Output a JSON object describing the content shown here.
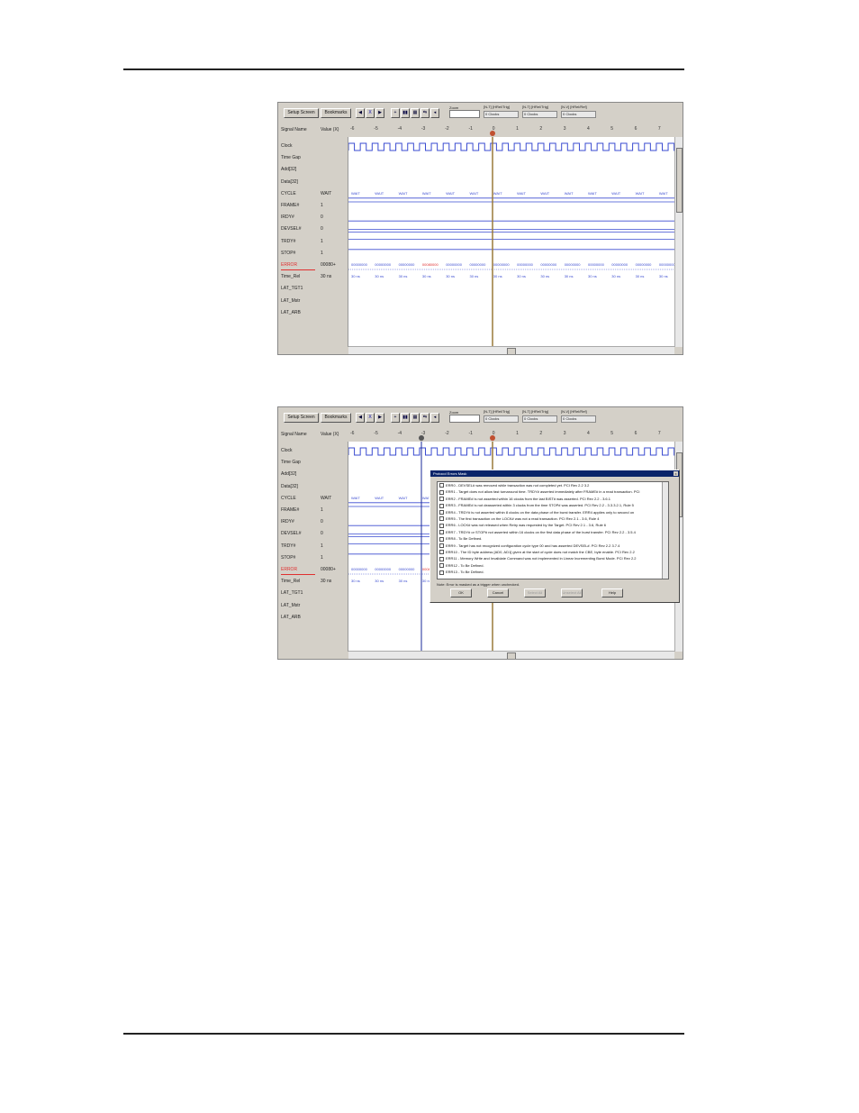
{
  "toolbar": {
    "setup_screen": "Setup Screen",
    "bookmarks": "Bookmarks",
    "zoom_label": "Zoom",
    "readouts": [
      {
        "label": "[N-T] [HRel/Trig]",
        "value": "0 Clocks"
      },
      {
        "label": "[N-T] [HRel/Trig]",
        "value": "0 Clocks"
      },
      {
        "label": "[N-V] [HRel/Ref]",
        "value": "0 Clocks"
      }
    ]
  },
  "header": {
    "signal_name": "Signal Name",
    "value_label": "Value (X)",
    "ticks": [
      "-6",
      "-5",
      "-4",
      "-3",
      "-2",
      "-1",
      "0",
      "1",
      "2",
      "3",
      "4",
      "5",
      "6",
      "7"
    ]
  },
  "signals": [
    {
      "name": "Clock",
      "value": ""
    },
    {
      "name": "Time Gap",
      "value": ""
    },
    {
      "name": "Add[32]",
      "value": ""
    },
    {
      "name": "Data[32]",
      "value": ""
    },
    {
      "name": "CYCLE",
      "value": "WAIT"
    },
    {
      "name": "FRAME#",
      "value": "1"
    },
    {
      "name": "IRDY#",
      "value": "0"
    },
    {
      "name": "DEVSEL#",
      "value": "0"
    },
    {
      "name": "TRDY#",
      "value": "1"
    },
    {
      "name": "STOP#",
      "value": "1"
    },
    {
      "name": "ERROR",
      "value": "00080+",
      "color": "#e03030"
    },
    {
      "name": "Time_Rel",
      "value": "30 ns"
    },
    {
      "name": "LAT_TGT1",
      "value": ""
    },
    {
      "name": "LAT_Mstr",
      "value": ""
    },
    {
      "name": "LAT_ARB",
      "value": ""
    }
  ],
  "cycle_cells": [
    "WAIT",
    "WAIT",
    "WAIT",
    "WAIT",
    "WAIT",
    "WAIT",
    "WAIT",
    "WAIT",
    "WAIT",
    "WAIT",
    "WAIT",
    "WAIT",
    "WAIT",
    "WAIT"
  ],
  "error_cells": [
    "00000000",
    "00000000",
    "00000000",
    "00080000",
    "00000000",
    "00000000",
    "00000000",
    "00000000",
    "00000000",
    "00000000",
    "00000000",
    "00000000",
    "00000000",
    "00000000"
  ],
  "time_cells": [
    "30 ns",
    "30 ns",
    "30 ns",
    "30 ns",
    "30 ns",
    "30 ns",
    "30 ns",
    "30 ns",
    "30 ns",
    "30 ns",
    "30 ns",
    "30 ns",
    "30 ns",
    "30 ns"
  ],
  "markers": {
    "cursor_o": "O",
    "cursor_x": "X"
  },
  "dialog": {
    "title": "Protocol Errors Mask",
    "rows": [
      "ERR0 - DEVSEL# was removed while transaction was not completed yet. PCI Rev 2.2 3.2",
      "ERR1 - Target does not allow fast turnaround time. TRDY# asserted immediately after FRAME# in a read transaction. PCI",
      "ERR2 - FRAME# is not asserted within 16 clocks from the last BIST# was asserted. PCI Rev 2.2 - 3.6.1",
      "ERR3 - FRAME# is not deasserted within 3 clocks from the time STOP# was asserted. PCI Rev 2.2 - 3.3.3.2.1, Rule 5",
      "ERR4 - TRDY# is not asserted within 8 clocks on the data phase of the burst transfer. ERR4 applies only to second on",
      "ERR5 - The first transaction on the LOCK# was not a read transaction. PCI Rev 2.1 - 3.6, Rule 4",
      "ERR6 - LOCK# was not released when Retry was requested by the Target. PCI Rev 2.1 - 3.6, Rule 6",
      "ERR7 - TRDY# or STOP# not asserted within 16 clocks on the first data phase of the burst transfer. PCI Rev 2.2 - 3.5.4",
      "ERR8 - To Be Defined.",
      "ERR9 - Target has not recognized configuration cycle type 00 and has asserted DEVSEL#. PCI Rev 2.2 3.7.4",
      "ERR10 - The ID byte address [AD0, AD1] given at the start of cycle does not match the CBE, byte enable. PCI Rev 2.2",
      "ERR11 - Memory Write and Invalidate Command was not implemented in Linear Incrementing Burst Mode. PCI Rev 2.2",
      "ERR12 - To Be Defined.",
      "ERR13 - To Be Defined."
    ],
    "note": "Note: Error is masked as a trigger when unchecked.",
    "buttons": {
      "ok": "OK",
      "cancel": "Cancel",
      "select_all": "Select All",
      "unselect_all": "Unselect All",
      "help": "Help"
    }
  }
}
